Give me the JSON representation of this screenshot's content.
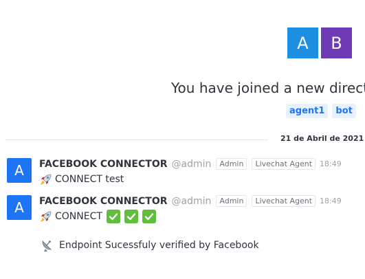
{
  "join_banner": {
    "avatars": [
      {
        "letter": "A",
        "color": "#1d8fe1"
      },
      {
        "letter": "B",
        "color": "#6e3ab5"
      }
    ],
    "text": "You have joined a new direct",
    "tags": [
      "agent1",
      "bot"
    ]
  },
  "date_divider": "21 de Abril de 2021",
  "messages": [
    {
      "avatar_letter": "A",
      "sender": "FACEBOOK CONNECTOR",
      "username": "@admin",
      "roles": [
        "Admin",
        "Livechat Agent"
      ],
      "time": "18:49",
      "text": "CONNECT test",
      "icon": "rocket-icon"
    },
    {
      "avatar_letter": "A",
      "sender": "FACEBOOK CONNECTOR",
      "username": "@admin",
      "roles": [
        "Admin",
        "Livechat Agent"
      ],
      "time": "18:49",
      "text": "CONNECT",
      "icon": "rocket-icon",
      "checkmarks": [
        "check-mark-icon",
        "check-mark-icon",
        "check-mark-icon"
      ]
    }
  ],
  "system_message": {
    "icon": "satellite-dish-icon",
    "text": "Endpoint Sucessfuly verified by Facebook"
  },
  "colors": {
    "accent": "#1d74f5",
    "check": "#5fbf3c"
  }
}
